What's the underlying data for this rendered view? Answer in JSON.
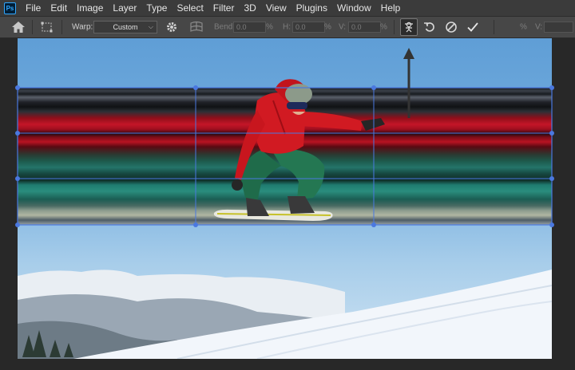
{
  "app": {
    "logo_text": "Ps"
  },
  "menu": [
    "File",
    "Edit",
    "Image",
    "Layer",
    "Type",
    "Select",
    "Filter",
    "3D",
    "View",
    "Plugins",
    "Window",
    "Help"
  ],
  "options": {
    "warp_label": "Warp:",
    "warp_value": "Custom",
    "bend_label": "Bend:",
    "bend_value": "0.0",
    "h_label": "H:",
    "h_value": "0.0",
    "v_label": "V:",
    "v_value": "0.0",
    "percent": "%",
    "right_percent": "%",
    "right_v_label": "V:"
  },
  "colors": {
    "menubar": "#3b3b3b",
    "optionsbar": "#474747",
    "grid": "#4a78e0",
    "sky": "#7ab1e0",
    "jacket": "#d11a22",
    "pants": "#1f6b4a"
  },
  "icons": {
    "home": "home-icon",
    "marquee": "transform-marquee-icon",
    "settings": "gear-icon",
    "warp_mode": "warp-mesh-icon",
    "puppet": "puppet-warp-icon",
    "undo": "undo-icon",
    "cancel": "cancel-icon",
    "commit": "checkmark-icon"
  }
}
